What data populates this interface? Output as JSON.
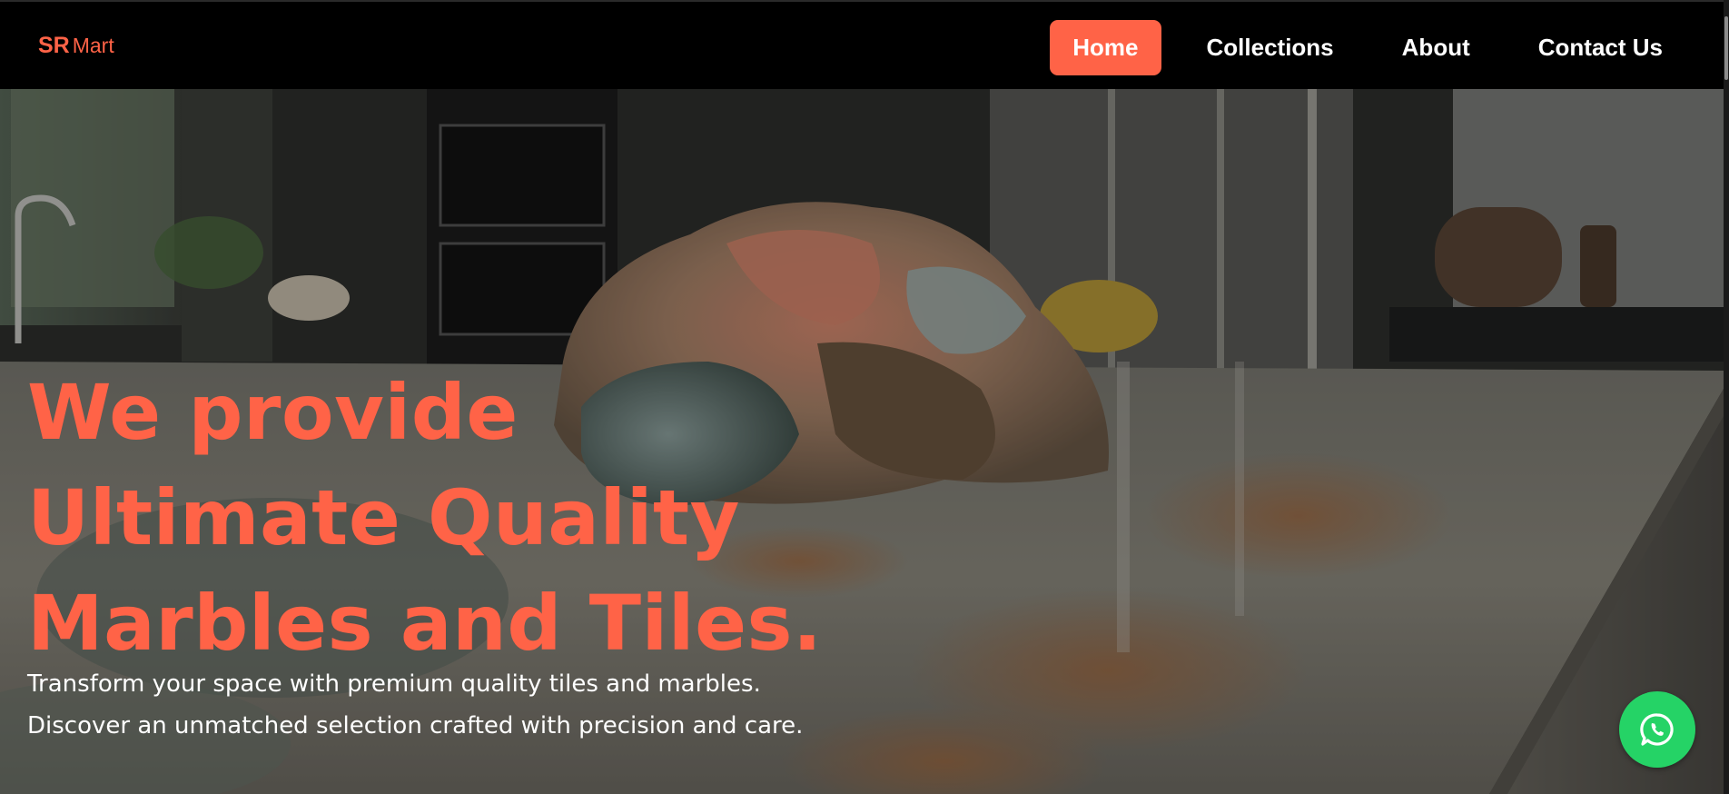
{
  "brand": {
    "name_bold": "SR",
    "name_light": "Mart",
    "accent_color": "#ff6347"
  },
  "nav": {
    "items": [
      {
        "label": "Home",
        "active": true
      },
      {
        "label": "Collections",
        "active": false
      },
      {
        "label": "About",
        "active": false
      },
      {
        "label": "Contact Us",
        "active": false
      }
    ]
  },
  "hero": {
    "title_lines": [
      "We provide",
      "Ultimate Quality",
      "Marbles and Tiles."
    ],
    "subtitle_lines": [
      "Transform your space with premium quality tiles and marbles.",
      "Discover an unmatched selection crafted with precision and care."
    ],
    "background_icon": "kitchen-marble-countertop-photo"
  },
  "floating": {
    "whatsapp_icon": "whatsapp-icon",
    "whatsapp_color": "#25d366"
  }
}
